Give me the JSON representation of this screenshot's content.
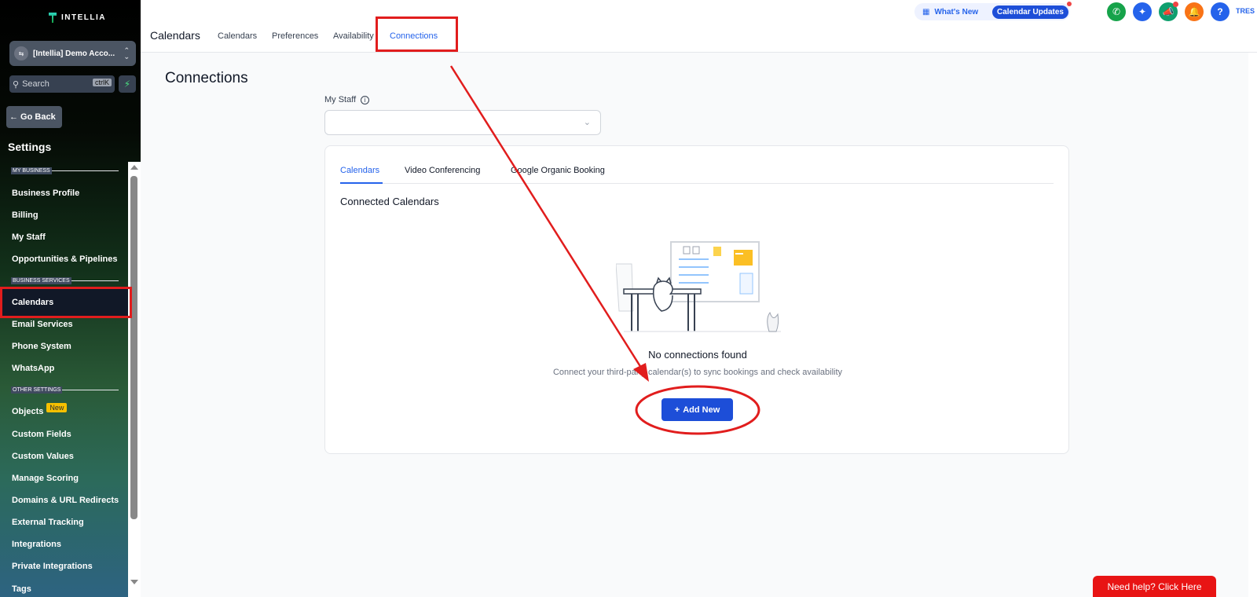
{
  "sidebar": {
    "brand": "INTELLIA",
    "account": "[Intellia] Demo Acco...",
    "search_placeholder": "Search",
    "search_kbd": "ctrlK",
    "go_back": "← Go Back",
    "settings_title": "Settings",
    "sections": {
      "my_business": "MY BUSINESS",
      "business_services": "BUSINESS SERVICES",
      "other_settings": "OTHER SETTINGS"
    },
    "items": {
      "business_profile": "Business Profile",
      "billing": "Billing",
      "my_staff": "My Staff",
      "opportunities": "Opportunities & Pipelines",
      "calendars": "Calendars",
      "email_services": "Email Services",
      "phone_system": "Phone System",
      "whatsapp": "WhatsApp",
      "objects": "Objects",
      "objects_badge": "New",
      "custom_fields": "Custom Fields",
      "custom_values": "Custom Values",
      "manage_scoring": "Manage Scoring",
      "domains": "Domains & URL Redirects",
      "external_tracking": "External Tracking",
      "integrations": "Integrations",
      "private_integrations": "Private Integrations",
      "tags": "Tags"
    }
  },
  "header": {
    "page_title": "Calendars",
    "tabs": {
      "calendars": "Calendars",
      "preferences": "Preferences",
      "availability": "Availability",
      "connections": "Connections"
    },
    "whats_new": "What's New",
    "calendar_updates": "Calendar Updates",
    "user_initials": "TRES",
    "icon_colors": {
      "phone": "#16a34a",
      "magic": "#2563eb",
      "announce": "#0f9f6e",
      "bell": "#f97316",
      "help": "#2563eb"
    }
  },
  "main": {
    "title": "Connections",
    "staff_label": "My Staff",
    "card": {
      "tabs": {
        "calendars": "Calendars",
        "video": "Video Conferencing",
        "google": "Google Organic Booking"
      },
      "section_title": "Connected Calendars",
      "empty_title": "No connections found",
      "empty_sub": "Connect your third-party calendar(s) to sync bookings and check availability",
      "add_new": "Add New"
    }
  },
  "help_button": "Need help? Click Here",
  "colors": {
    "accent": "#2563eb",
    "annotation": "#e11d1d"
  }
}
